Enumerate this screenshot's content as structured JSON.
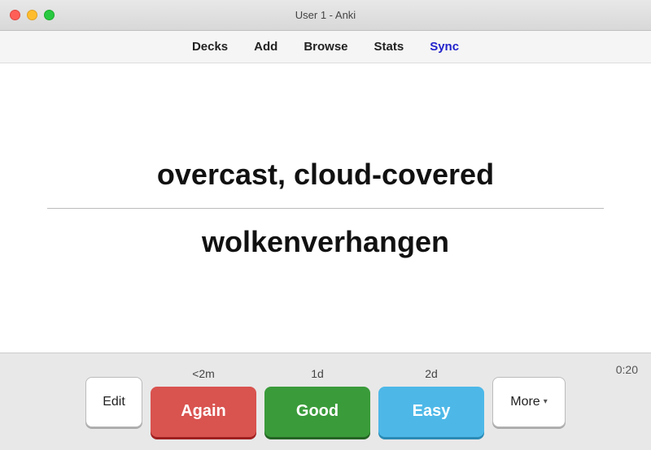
{
  "titlebar": {
    "title": "User 1 - Anki"
  },
  "toolbar": {
    "items": [
      {
        "label": "Decks",
        "id": "decks",
        "active": false
      },
      {
        "label": "Add",
        "id": "add",
        "active": false
      },
      {
        "label": "Browse",
        "id": "browse",
        "active": false
      },
      {
        "label": "Stats",
        "id": "stats",
        "active": false
      },
      {
        "label": "Sync",
        "id": "sync",
        "active": true
      }
    ]
  },
  "card": {
    "front": "overcast, cloud-covered",
    "back": "wolkenverhangen"
  },
  "answer_bar": {
    "timer": "0:20",
    "edit_label": "Edit",
    "again_label": "Again",
    "again_interval": "<2m",
    "good_label": "Good",
    "good_interval": "1d",
    "easy_label": "Easy",
    "easy_interval": "2d",
    "more_label": "More"
  },
  "icons": {
    "chevron_down": "▾",
    "close": "●",
    "minimize": "●",
    "maximize": "●"
  }
}
